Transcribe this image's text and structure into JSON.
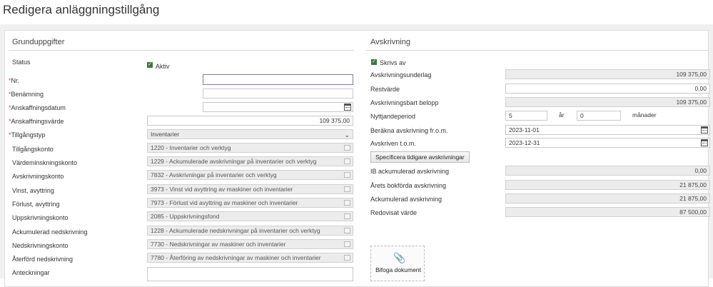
{
  "page": {
    "title": "Redigera anläggningstillgång"
  },
  "left": {
    "section_title": "Grunduppgifter",
    "status_label": "Status",
    "aktiv_label": "Aktiv",
    "nr_label": "Nr.",
    "benamning_label": "Benämning",
    "anskaffningsdatum_label": "Anskaffningsdatum",
    "anskaffningsvarde_label": "Anskaffningsvärde",
    "anskaffningsvarde_value": "109 375,00",
    "tillgangstyp_label": "Tillgångstyp",
    "tillgangstyp_value": "Inventarier",
    "rows": [
      {
        "label": "Tillgångskonto",
        "value": "1220 - Inventarier och verktyg"
      },
      {
        "label": "Värdeminskningskonto",
        "value": "1229 - Ackumulerade avskrivningar på inventarier och verktyg"
      },
      {
        "label": "Avskrivningskonto",
        "value": "7832 - Avskrivningar på inventarier och verktyg"
      },
      {
        "label": "Vinst, avyttring",
        "value": "3973 - Vinst vid avyttring av maskiner och inventarier"
      },
      {
        "label": "Förlust, avyttring",
        "value": "7973 - Förlust vid avyttring av maskiner och inventarier"
      },
      {
        "label": "Uppskrivningskonto",
        "value": "2085 - Uppskrivningsfond"
      },
      {
        "label": "Ackumulerad nedskrivning",
        "value": "1228 - Ackumulerade nedskrivningar på inventarier och verktyg"
      },
      {
        "label": "Nedskrivningskonto",
        "value": "7730 - Nedskrivningar av maskiner och inventarier"
      },
      {
        "label": "Återförd nedskrivning",
        "value": "7780 - Återföring av nedskrivningar av maskiner och inventarier"
      }
    ],
    "anteckningar_label": "Anteckningar"
  },
  "right": {
    "section_title": "Avskrivning",
    "skrivs_av_label": "Skrivs av",
    "avskrivningsunderlag_label": "Avskrivningsunderlag",
    "avskrivningsunderlag_value": "109 375,00",
    "restvarde_label": "Restvärde",
    "restvarde_value": "0,00",
    "avskrivningsbart_label": "Avskrivningsbart belopp",
    "avskrivningsbart_value": "109 375,00",
    "nyttjandeperiod_label": "Nyttjandeperiod",
    "nyttjandeperiod_years": "5",
    "years_unit": "år",
    "nyttjandeperiod_months": "0",
    "months_unit": "månader",
    "berakna_label": "Beräkna avskrivning fr.o.m.",
    "berakna_value": "2023-11-01",
    "avskriven_label": "Avskriven t.o.m.",
    "avskriven_value": "2023-12-31",
    "specificera_button": "Specificera tidigare avskrivningar",
    "ib_label": "IB ackumulerad avskrivning",
    "ib_value": "0,00",
    "arets_label": "Årets bokförda avskrivning",
    "arets_value": "21 875,00",
    "ackumulerad_label": "Ackumulerad avskrivning",
    "ackumulerad_value": "21 875,00",
    "redovisat_label": "Redovisat värde",
    "redovisat_value": "87 500,00",
    "attach_label": "Bifoga dokument"
  }
}
